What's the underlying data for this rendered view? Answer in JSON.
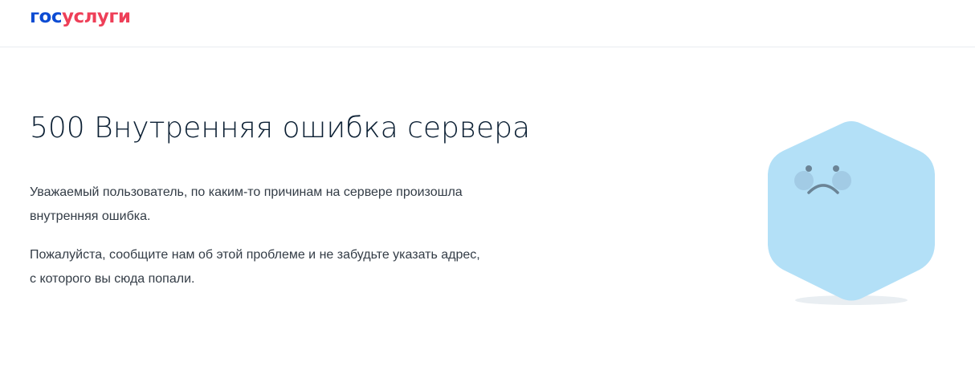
{
  "header": {
    "logo_part_a": "гос",
    "logo_part_b": "услуги",
    "logo_colors": {
      "primary": "#0d4cd3",
      "accent": "#ee3f58"
    }
  },
  "error": {
    "title": "500 Внутренняя ошибка сервера",
    "paragraph1_line1": "Уважаемый пользователь, по каким-то причинам на сервере произошла",
    "paragraph1_line2": "внутренняя ошибка.",
    "paragraph2_line1": "Пожалуйста, сообщите нам об этой проблеме и не забудьте указать адрес,",
    "paragraph2_line2": "с которого вы сюда попали."
  },
  "illustration": {
    "icon": "sad-hexagon-mascot-icon",
    "fill_color": "#b3e0f7",
    "cheek_color": "#9fc7e2",
    "face_color": "#6b8496",
    "shadow_color": "#e9eef2"
  }
}
